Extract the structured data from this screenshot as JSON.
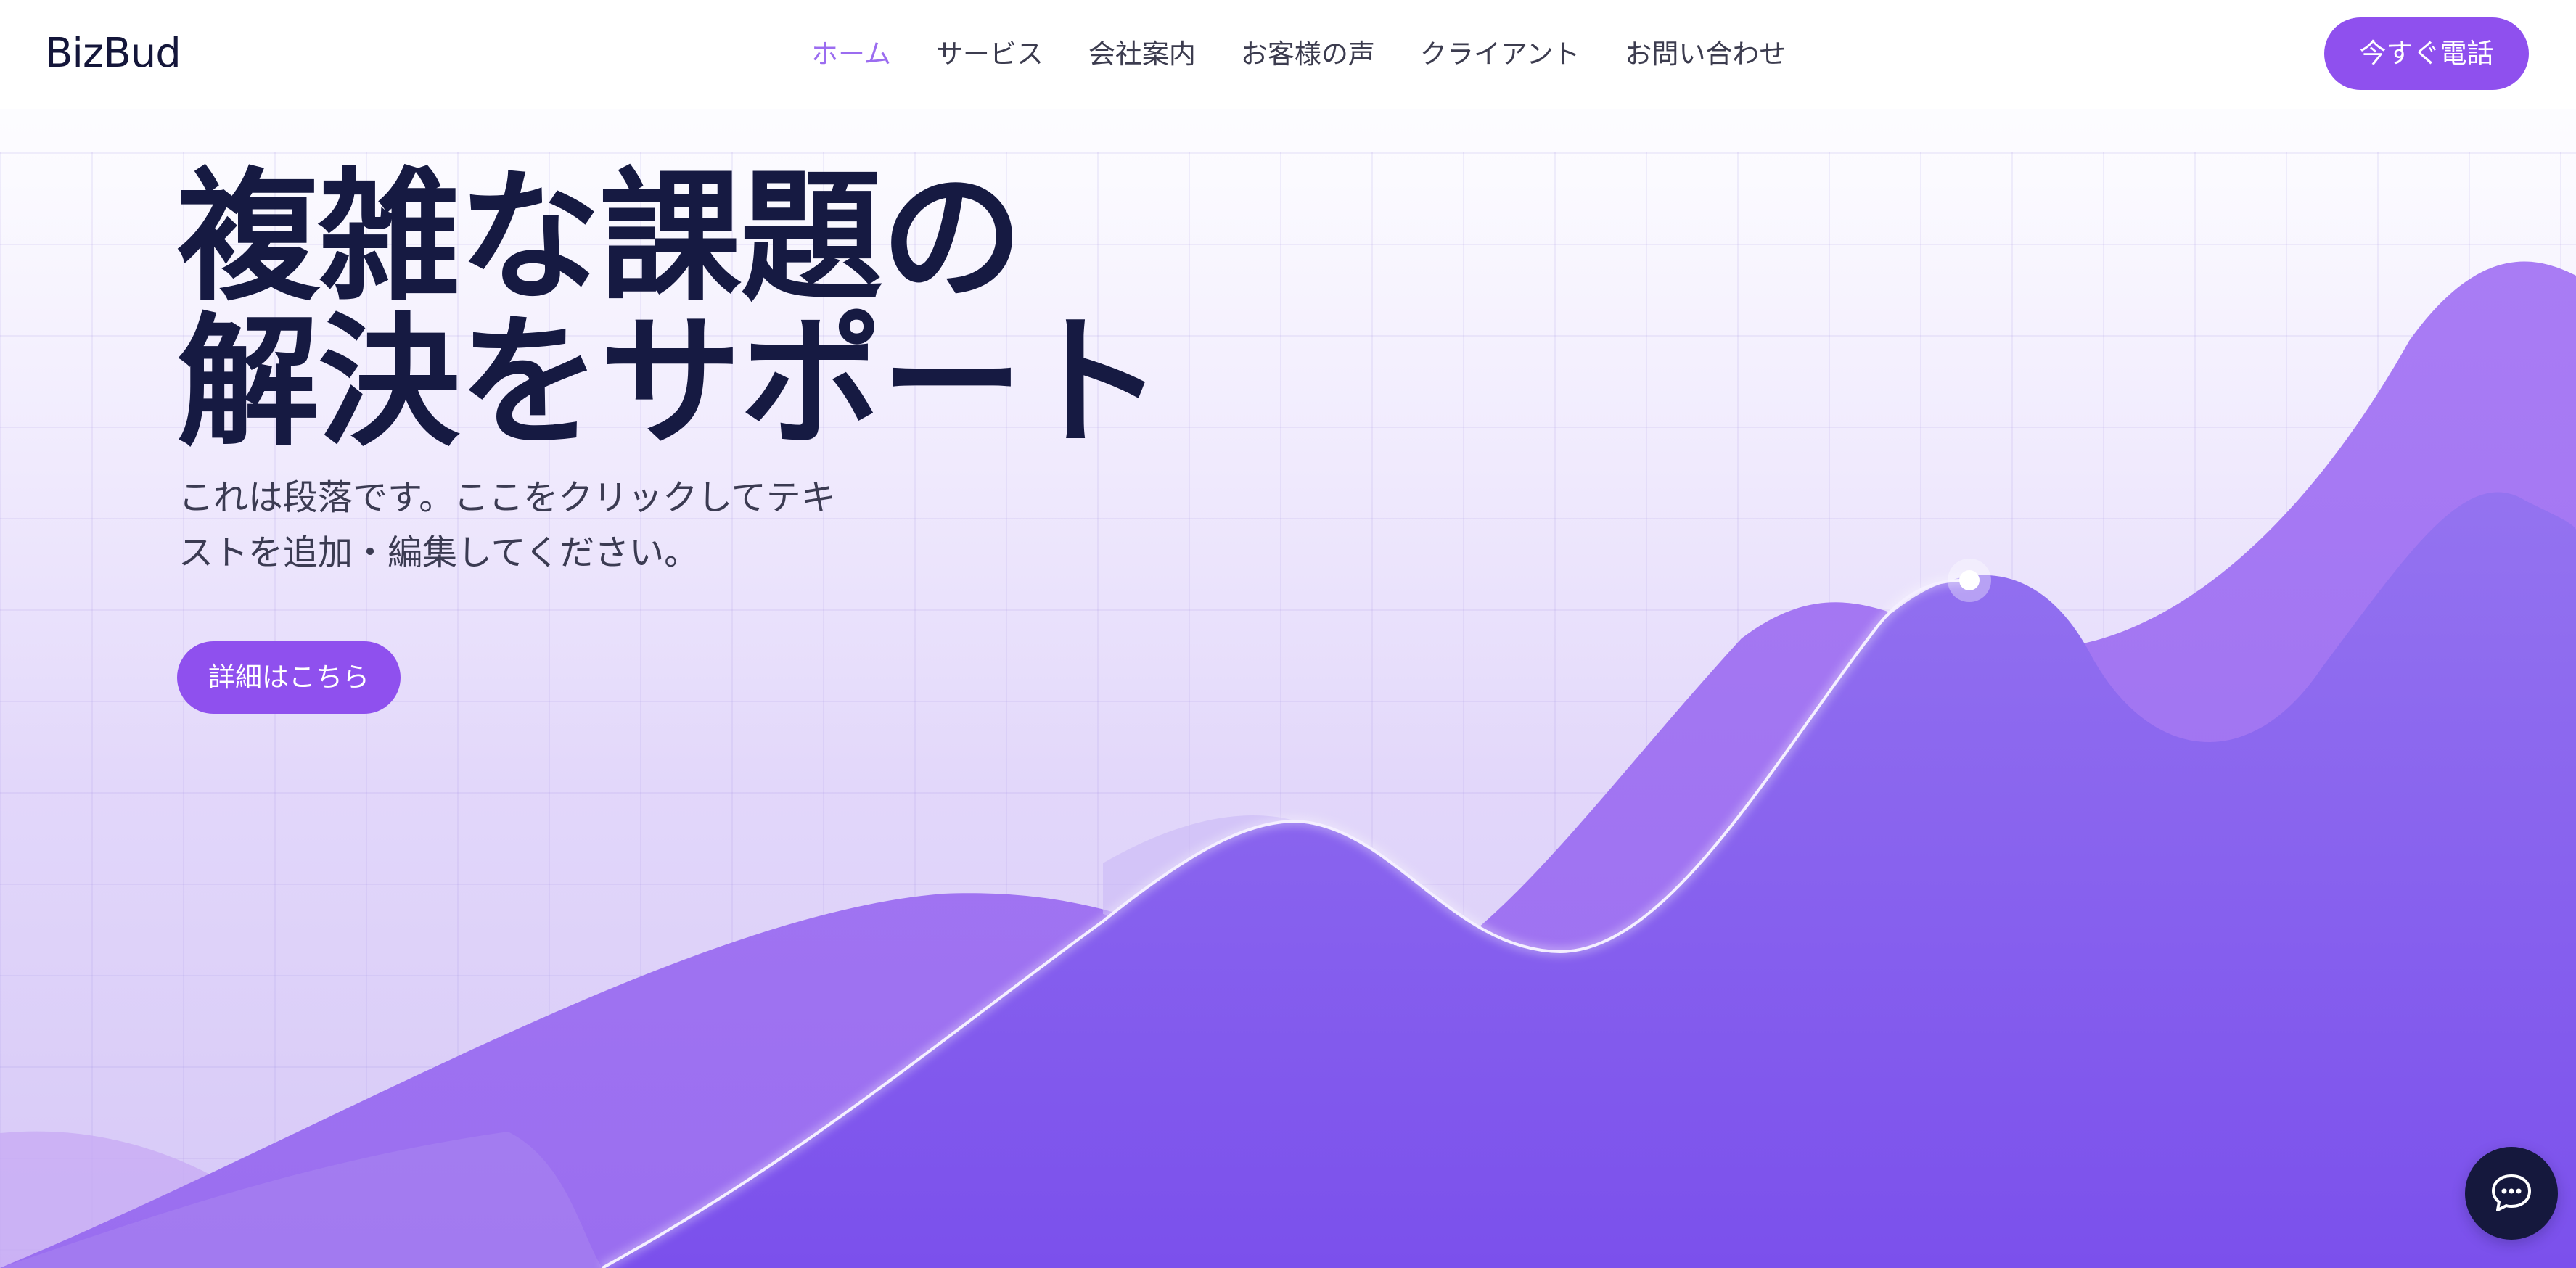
{
  "brand": {
    "logo_text": "BizBud"
  },
  "nav": {
    "items": [
      {
        "label": "ホーム",
        "active": true
      },
      {
        "label": "サービス",
        "active": false
      },
      {
        "label": "会社案内",
        "active": false
      },
      {
        "label": "お客様の声",
        "active": false
      },
      {
        "label": "クライアント",
        "active": false
      },
      {
        "label": "お問い合わせ",
        "active": false
      }
    ]
  },
  "header": {
    "cta_label": "今すぐ電話"
  },
  "hero": {
    "title_line1": "複雑な課題の",
    "title_line2": "解決をサポート",
    "paragraph_line1": "これは段落です。ここをクリックしてテキ",
    "paragraph_line2": "ストを追加・編集してください。",
    "button_label": "詳細はこちら"
  },
  "chat": {
    "icon": "chat-bubble-icon"
  },
  "colors": {
    "accent": "#8f50ee",
    "nav_active": "#9b6cf0",
    "heading": "#161a42",
    "wave_light": "#a57af2",
    "wave_deep": "#7b50ec",
    "chat_bg": "#15183d"
  }
}
